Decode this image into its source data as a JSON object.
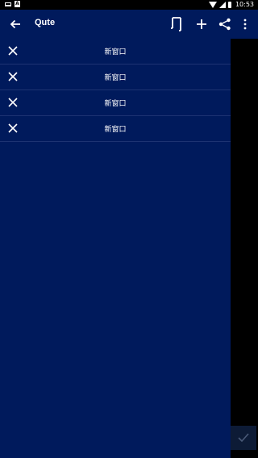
{
  "status_bar": {
    "time": "10:53",
    "left_icons": [
      "laptop-icon",
      "a-icon"
    ],
    "right_icons": [
      "wifi-icon",
      "signal-icon",
      "battery-icon"
    ]
  },
  "app_bar": {
    "title": "Qute",
    "back_icon": "arrow-left-icon",
    "actions": [
      "tabs-icon",
      "plus-icon",
      "share-icon",
      "more-vert-icon"
    ]
  },
  "tabs": [
    {
      "title": "新窗口"
    },
    {
      "title": "新窗口"
    },
    {
      "title": "新窗口"
    },
    {
      "title": "新窗口"
    }
  ],
  "confirm_icon": "check-icon",
  "colors": {
    "app_bar": "#001a5c",
    "drawer": "#001a5c",
    "divider": "#1d3372",
    "background": "#000000",
    "text": "#ffffff"
  }
}
